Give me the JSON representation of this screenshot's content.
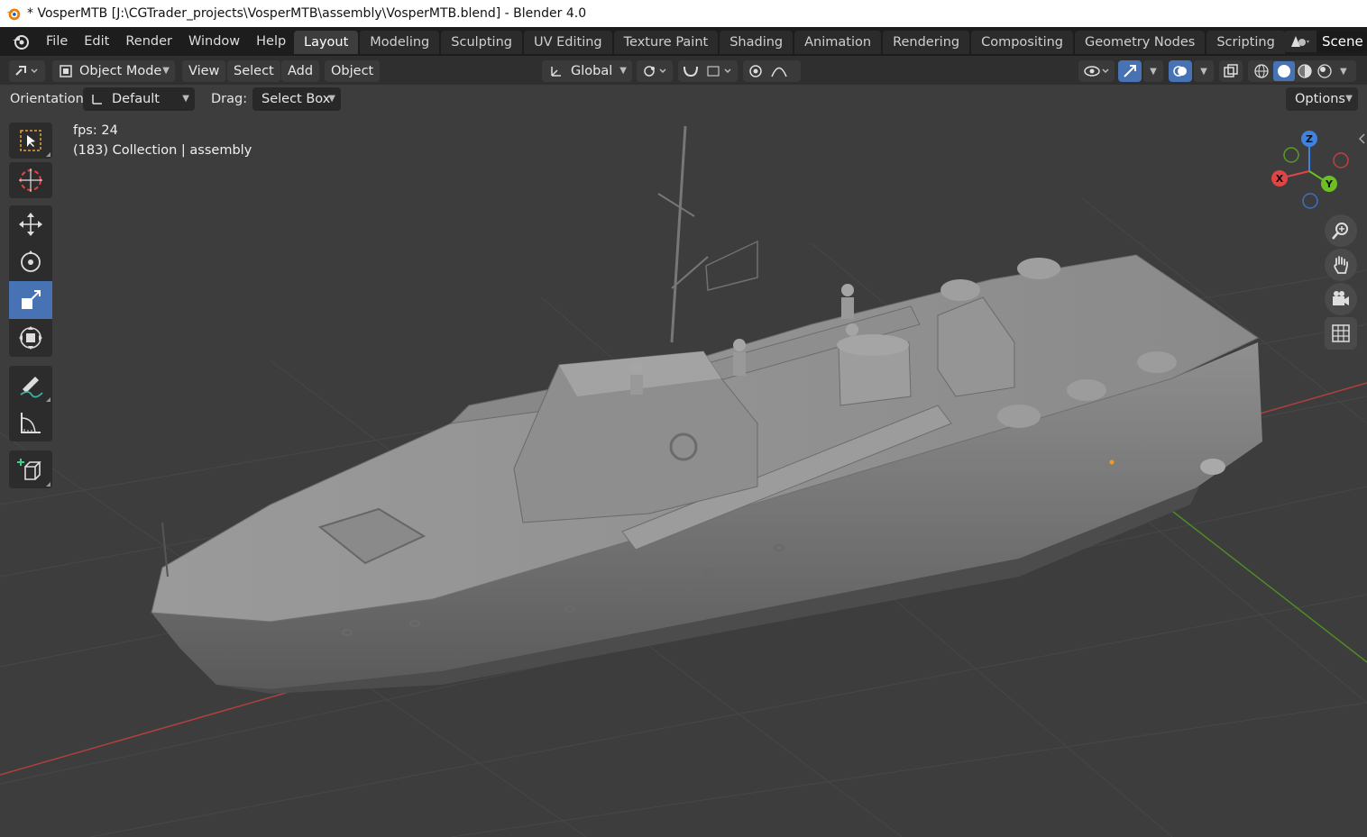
{
  "window": {
    "title": "* VosperMTB [J:\\CGTrader_projects\\VosperMTB\\assembly\\VosperMTB.blend] - Blender 4.0"
  },
  "menu": [
    "File",
    "Edit",
    "Render",
    "Window",
    "Help"
  ],
  "workspaces": [
    {
      "label": "Layout",
      "active": true
    },
    {
      "label": "Modeling"
    },
    {
      "label": "Sculpting"
    },
    {
      "label": "UV Editing"
    },
    {
      "label": "Texture Paint"
    },
    {
      "label": "Shading"
    },
    {
      "label": "Animation"
    },
    {
      "label": "Rendering"
    },
    {
      "label": "Compositing"
    },
    {
      "label": "Geometry Nodes"
    },
    {
      "label": "Scripting"
    }
  ],
  "scene": {
    "name": "Scene"
  },
  "header": {
    "mode": "Object Mode",
    "view": "View",
    "select": "Select",
    "add": "Add",
    "object": "Object",
    "transform_orientation": "Global"
  },
  "tool_settings": {
    "orientation_label": "Orientation:",
    "orientation_value": "Default",
    "drag_label": "Drag:",
    "drag_value": "Select Box",
    "options": "Options"
  },
  "viewport": {
    "fps": "fps: 24",
    "collection_info": "(183) Collection | assembly"
  },
  "gizmo": {
    "x": "X",
    "y": "Y",
    "z": "Z"
  },
  "colors": {
    "accent": "#4772b3",
    "x_axis": "#e04444",
    "y_axis": "#6bbf24",
    "z_axis": "#3f82e0"
  }
}
